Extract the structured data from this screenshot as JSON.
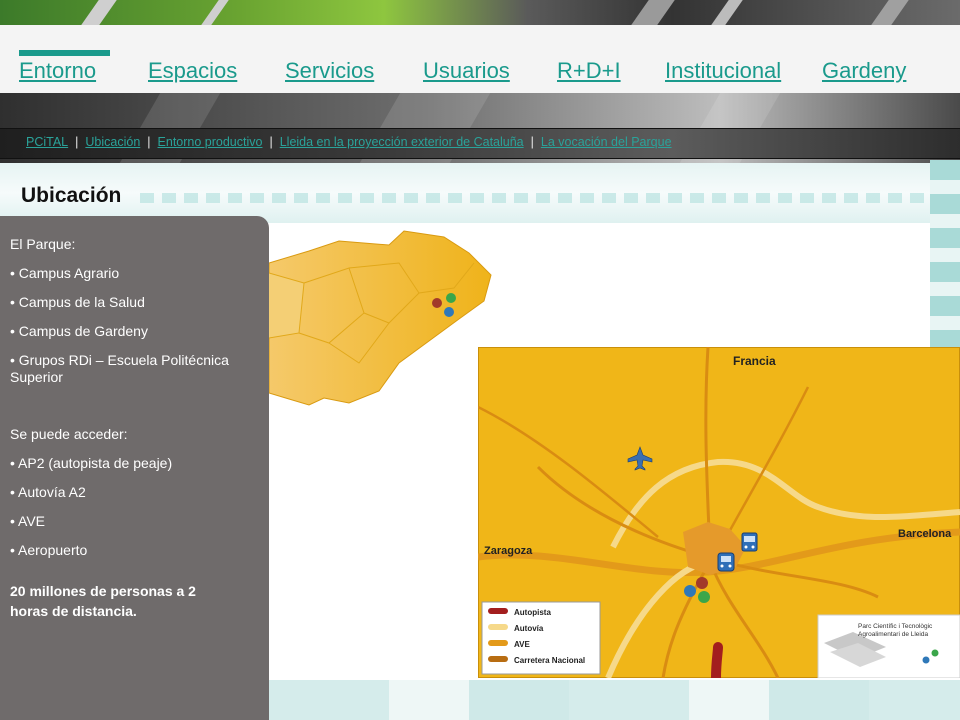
{
  "nav": {
    "items": [
      {
        "label": "Entorno"
      },
      {
        "label": "Espacios"
      },
      {
        "label": "Servicios"
      },
      {
        "label": "Usuarios"
      },
      {
        "label": "R+D+I"
      },
      {
        "label": "Institucional"
      },
      {
        "label": "Gardeny"
      }
    ],
    "active": "Entorno",
    "accent": "#1a9a8c"
  },
  "subnav": {
    "items": [
      {
        "label": "PCiTAL"
      },
      {
        "label": "Ubicación"
      },
      {
        "label": "Entorno productivo"
      },
      {
        "label": "Lleida en la proyección exterior de Cataluña"
      },
      {
        "label": "La vocación del Parque"
      }
    ],
    "separator": "|"
  },
  "page_title": "Ubicación",
  "sidebar": {
    "park_heading": "El Parque:",
    "park_items": [
      "• Campus Agrario",
      "• Campus de la Salud",
      "• Campus de Gardeny",
      "• Grupos RDi – Escuela Politécnica Superior"
    ],
    "access_heading": "Se puede acceder:",
    "access_items": [
      "• AP2 (autopista de peaje)",
      "• Autovía A2",
      "• AVE",
      "• Aeropuerto"
    ],
    "highlight": "20 millones de personas a 2 horas de distancia.",
    "background": "#6f6b6b"
  },
  "map": {
    "labels": {
      "north": "Francia",
      "west": "Zaragoza",
      "east": "Barcelona"
    },
    "legend": [
      {
        "label": "Autopista",
        "color": "#a31e1e"
      },
      {
        "label": "Autovía",
        "color": "#f6d98a"
      },
      {
        "label": "AVE",
        "color": "#e39a1a"
      },
      {
        "label": "Carretera Nacional",
        "color": "#b86d12"
      }
    ],
    "logo_text": [
      "Parc Científic i Tecnològic",
      "Agroalimentari de Lleida"
    ],
    "icons": [
      "airplane-icon",
      "train-icon",
      "bus-icon"
    ],
    "land_color": "#f0b618",
    "water_color": "#ffffff"
  }
}
